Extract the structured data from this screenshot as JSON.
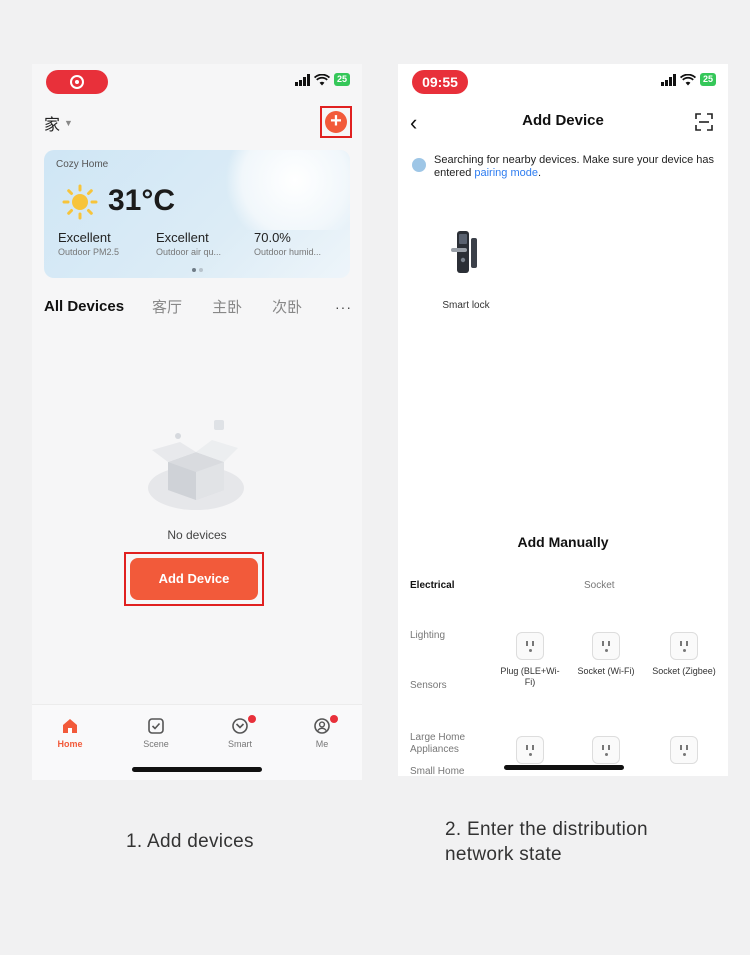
{
  "left_screen": {
    "home_selector": "家",
    "weather": {
      "home_name": "Cozy Home",
      "temperature": "31°C",
      "metrics": [
        {
          "value": "Excellent",
          "label": "Outdoor PM2.5"
        },
        {
          "value": "Excellent",
          "label": "Outdoor air qu..."
        },
        {
          "value": "70.0%",
          "label": "Outdoor humid..."
        }
      ]
    },
    "rooms": [
      "All Devices",
      "客厅",
      "主卧",
      "次卧"
    ],
    "more": "···",
    "empty_text": "No devices",
    "add_device_label": "Add Device",
    "tabs": [
      {
        "label": "Home"
      },
      {
        "label": "Scene"
      },
      {
        "label": "Smart"
      },
      {
        "label": "Me"
      }
    ],
    "accent_color": "#f25a3a"
  },
  "right_screen": {
    "time": "09:55",
    "battery": "25",
    "title": "Add Device",
    "search_text": "Searching for nearby devices. Make sure your device has entered",
    "search_link": "pairing mode",
    "search_end": ".",
    "found_device": "Smart lock",
    "add_manually": "Add Manually",
    "sub_header": "Socket",
    "categories": [
      "Electrical",
      "Lighting",
      "Sensors",
      "Large Home Appliances",
      "Small Home"
    ],
    "products": [
      {
        "label": "Plug (BLE+Wi-Fi)"
      },
      {
        "label": "Socket (Wi-Fi)"
      },
      {
        "label": "Socket (Zigbee)"
      }
    ]
  },
  "left_battery": "25",
  "captions": {
    "left": "1. Add devices",
    "right": "2. Enter the distribution network state"
  }
}
